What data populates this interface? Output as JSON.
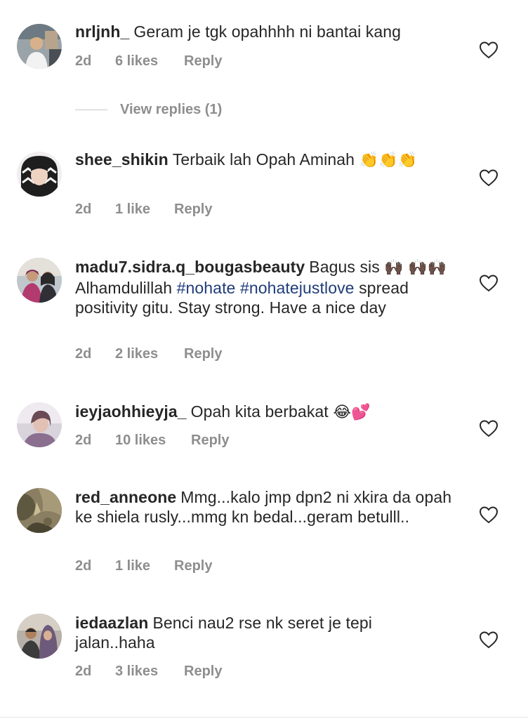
{
  "comments": [
    {
      "username": "nrljnh_",
      "text": "Geram je tgk opahhhh ni bantai kang",
      "time": "2d",
      "likes": "6 likes",
      "reply": "Reply"
    },
    {
      "username": "shee_shikin",
      "text": "Terbaik lah Opah Aminah",
      "emoji": "👏👏👏",
      "time": "2d",
      "likes": "1 like",
      "reply": "Reply"
    },
    {
      "username": "madu7.sidra.q_bougasbeauty",
      "text_a": "Bagus sis",
      "emoji_a": "🙌🏿",
      "emoji_b": "🙌🏿🙌🏿",
      "text_b": "Alhamdulillah",
      "hashtag1": "#nohate",
      "hashtag2": "#nohatejustlove",
      "text_c": "spread positivity gitu. Stay strong. Have a nice day",
      "time": "2d",
      "likes": "2 likes",
      "reply": "Reply"
    },
    {
      "username": "ieyjaohhieyja_",
      "text": "Opah kita berbakat",
      "emoji": "😂💕",
      "time": "2d",
      "likes": "10 likes",
      "reply": "Reply"
    },
    {
      "username": "red_anneone",
      "text": "Mmg...kalo jmp dpn2 ni xkira da opah ke shiela rusly...mmg kn bedal...geram betulll..",
      "time": "2d",
      "likes": "1 like",
      "reply": "Reply"
    },
    {
      "username": "iedaazlan",
      "text": "Benci nau2 rse nk seret je tepi jalan..haha",
      "time": "2d",
      "likes": "3 likes",
      "reply": "Reply"
    }
  ],
  "view_replies": "View replies (1)",
  "icons": {
    "like": "heart-outline-icon"
  },
  "colors": {
    "text": "#262626",
    "meta": "#8e8e8e",
    "hashtag": "#1f3c7a"
  }
}
